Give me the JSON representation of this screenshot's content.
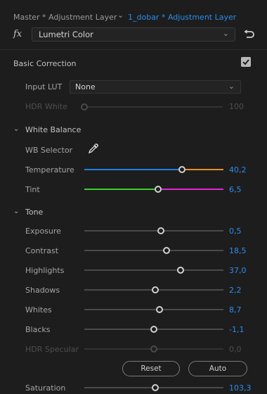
{
  "breadcrumb": {
    "master": "Master * Adjustment Layer",
    "clip": "1_dobar * Adjustment Layer"
  },
  "effect": {
    "fx_label": "fx",
    "name": "Lumetri Color"
  },
  "basic_correction": {
    "title": "Basic Correction",
    "enabled": true,
    "input_lut_label": "Input LUT",
    "input_lut_value": "None",
    "hdr_white": {
      "label": "HDR White",
      "value": "100",
      "position": 0.0
    }
  },
  "white_balance": {
    "title": "White Balance",
    "wb_selector_label": "WB Selector",
    "temperature": {
      "label": "Temperature",
      "value": "40,2",
      "position": 0.7,
      "colors": [
        "#1f7fe6",
        "#e8901c"
      ]
    },
    "tint": {
      "label": "Tint",
      "value": "6,5",
      "position": 0.53,
      "colors": [
        "#39d12b",
        "#e026d4"
      ]
    }
  },
  "tone": {
    "title": "Tone",
    "exposure": {
      "label": "Exposure",
      "value": "0,5",
      "position": 0.55
    },
    "contrast": {
      "label": "Contrast",
      "value": "18,5",
      "position": 0.59
    },
    "highlights": {
      "label": "Highlights",
      "value": "37,0",
      "position": 0.69
    },
    "shadows": {
      "label": "Shadows",
      "value": "2,2",
      "position": 0.51
    },
    "whites": {
      "label": "Whites",
      "value": "8,7",
      "position": 0.54
    },
    "blacks": {
      "label": "Blacks",
      "value": "-1,1",
      "position": 0.5
    },
    "hdr_specular": {
      "label": "HDR Specular",
      "value": "0,0",
      "position": 0.5
    },
    "reset_label": "Reset",
    "auto_label": "Auto"
  },
  "saturation": {
    "label": "Saturation",
    "value": "103,3",
    "position": 0.51
  },
  "colors": {
    "accent": "#2d8ceb",
    "background": "#1d1d1d"
  }
}
